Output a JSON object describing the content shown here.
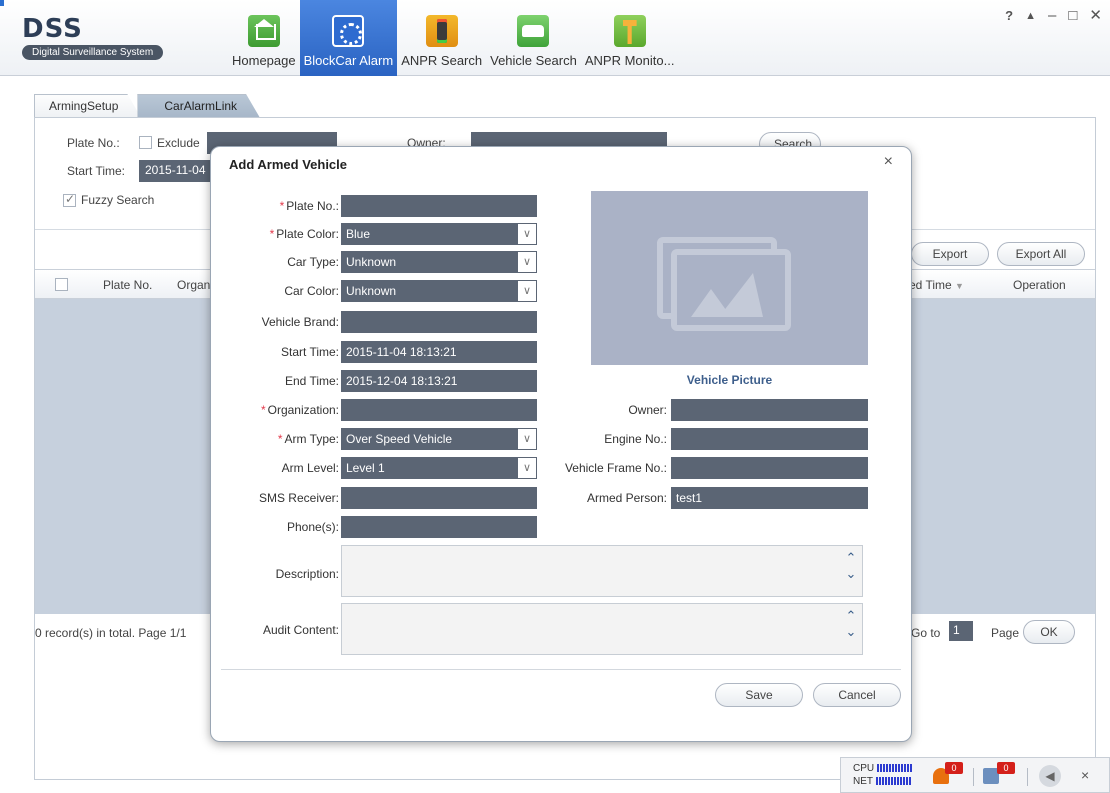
{
  "app": {
    "logo_title": "DSS",
    "logo_subtitle": "Digital Surveillance System"
  },
  "nav": [
    {
      "label": "Homepage",
      "icon": "home-icon",
      "active": false
    },
    {
      "label": "BlockCar Alarm",
      "icon": "blockcar-alarm-icon",
      "active": true
    },
    {
      "label": "ANPR Search",
      "icon": "traffic-light-icon",
      "active": false
    },
    {
      "label": "Vehicle Search",
      "icon": "car-search-icon",
      "active": false
    },
    {
      "label": "ANPR Monito...",
      "icon": "monitor-pole-icon",
      "active": false
    }
  ],
  "window_controls": {
    "help": "?",
    "lock": "🔒",
    "minimize": "–",
    "maximize": "□",
    "close": "✕"
  },
  "tabs": [
    {
      "label": "ArmingSetup"
    },
    {
      "label": "CarAlarmLink"
    }
  ],
  "search": {
    "plate_label": "Plate No.:",
    "exclude_label": "Exclude",
    "owner_label": "Owner:",
    "start_label": "Start Time:",
    "start_value": "2015-11-04",
    "fuzzy_label": "Fuzzy Search",
    "search_button": "Search"
  },
  "actions": {
    "export": "Export",
    "export_all": "Export All"
  },
  "grid": {
    "columns": [
      "Plate No.",
      "Organ",
      "ed Time",
      "Operation"
    ]
  },
  "pager": {
    "summary": "0 record(s) in total. Page 1/1",
    "goto_label": "Go to",
    "page_value": "1",
    "page_label": "Page",
    "ok": "OK"
  },
  "modal": {
    "title": "Add Armed Vehicle",
    "close": "×",
    "fields": {
      "plate_no": {
        "label": "Plate No.:",
        "value": "",
        "required": true
      },
      "plate_color": {
        "label": "Plate Color:",
        "value": "Blue",
        "required": true
      },
      "car_type": {
        "label": "Car Type:",
        "value": "Unknown"
      },
      "car_color": {
        "label": "Car Color:",
        "value": "Unknown"
      },
      "vehicle_brand": {
        "label": "Vehicle Brand:",
        "value": ""
      },
      "start_time": {
        "label": "Start Time:",
        "value": "2015-11-04 18:13:21"
      },
      "end_time": {
        "label": "End Time:",
        "value": "2015-12-04 18:13:21"
      },
      "organization": {
        "label": "Organization:",
        "value": "",
        "required": true
      },
      "arm_type": {
        "label": "Arm Type:",
        "value": "Over Speed Vehicle",
        "required": true
      },
      "arm_level": {
        "label": "Arm Level:",
        "value": "Level 1"
      },
      "sms_receiver": {
        "label": "SMS Receiver:",
        "value": ""
      },
      "phones": {
        "label": "Phone(s):",
        "value": ""
      },
      "owner": {
        "label": "Owner:",
        "value": ""
      },
      "engine_no": {
        "label": "Engine No.:",
        "value": ""
      },
      "vehicle_frame_no": {
        "label": "Vehicle Frame No.:",
        "value": ""
      },
      "armed_person": {
        "label": "Armed Person:",
        "value": "test1"
      },
      "description": {
        "label": "Description:",
        "value": ""
      },
      "audit_content": {
        "label": "Audit Content:",
        "value": ""
      }
    },
    "required_mark": "*",
    "picture_caption": "Vehicle Picture",
    "save": "Save",
    "cancel": "Cancel"
  },
  "statusbar": {
    "cpu": "CPU",
    "net": "NET",
    "alarm_count_1": "0",
    "alarm_count_2": "0"
  }
}
